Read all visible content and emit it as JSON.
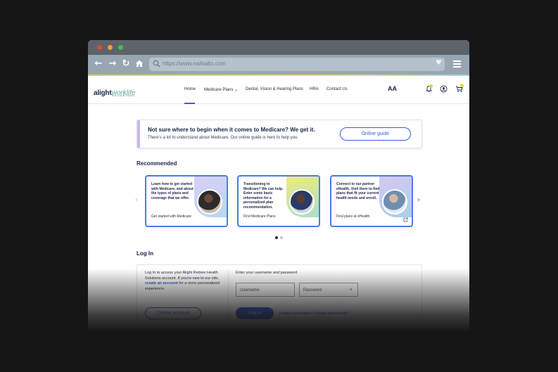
{
  "browser": {
    "url": "https://www.nailsalto.com"
  },
  "header": {
    "logo_main": "alight",
    "logo_accent": "worklife",
    "logo_sub": "Retiree Health Solutions",
    "nav": [
      "Home",
      "Medicare Plans",
      "Dental, Vision & Hearing Plans",
      "HRA",
      "Contact Us"
    ],
    "font_size_icon": "AA"
  },
  "banner": {
    "title": "Not sure where to begin when it comes to Medicare? We get it.",
    "text": "There’s a lot to understand about Medicare. Our online guide is here to help you.",
    "button": "Online guide"
  },
  "recommended": {
    "title": "Recommended",
    "cards": [
      {
        "text": "Learn how to get started with Medicare, and about the types of plans and coverage that we offer.",
        "link": "Get started with Medicare"
      },
      {
        "text": "Transitioning to Medicare? We can help. Enter some basic information for a personalized plan recommendation.",
        "link": "Find Medicare Plans"
      },
      {
        "text": "Connect to our partner eHealth. Visit them to find plans that fit your current health needs and enroll.",
        "link": "Find plans at eHealth"
      }
    ],
    "active_page": 1,
    "page_count": 2
  },
  "login": {
    "title": "Log In",
    "intro_before": "Log In to access your Alight Retiree Health Solutions account. If you’re new to our site, ",
    "intro_link": "create an account",
    "intro_after": " for a more personalized experience.",
    "prompt": "Enter your username and password",
    "username_placeholder": "Username",
    "password_placeholder": "Password",
    "create_button": "Create account",
    "login_button": "Log In",
    "forgot": "Forgot username? Forgot password?"
  },
  "colors": {
    "accent": "#3b5bdb",
    "brand_dark": "#1b2447",
    "badge": "#e3d82a"
  }
}
